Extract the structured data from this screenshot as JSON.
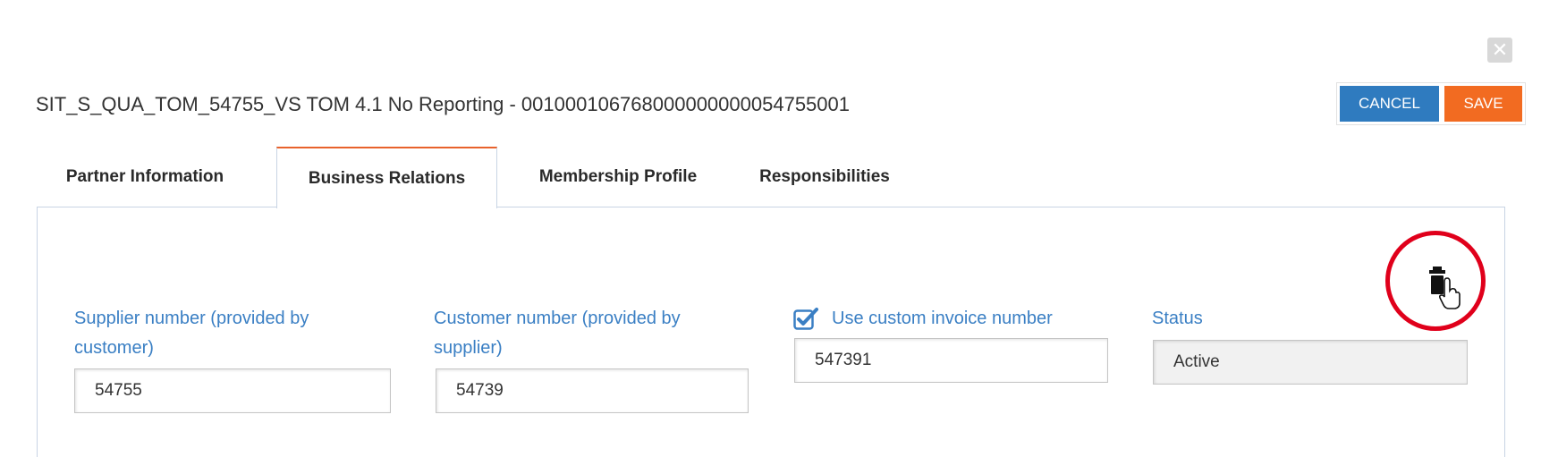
{
  "dialog": {
    "title": "SIT_S_QUA_TOM_54755_VS TOM 4.1 No Reporting - 001000106768000000000054755001",
    "close_icon": "close-icon",
    "actions": {
      "cancel_label": "CANCEL",
      "save_label": "SAVE",
      "cancel_color": "#2f7bbf",
      "save_color": "#f26b21"
    }
  },
  "tabs": [
    {
      "label": "Partner Information",
      "active": false
    },
    {
      "label": "Business Relations",
      "active": true
    },
    {
      "label": "Membership Profile",
      "active": false
    },
    {
      "label": "Responsibilities",
      "active": false
    }
  ],
  "fields": {
    "supplier_number": {
      "label_line1": "Supplier number (provided by",
      "label_line2": "customer)",
      "value": "54755"
    },
    "customer_number": {
      "label_line1": "Customer number (provided by",
      "label_line2": "supplier)",
      "value": "54739"
    },
    "custom_invoice": {
      "label": "Use custom invoice number",
      "checked": true,
      "value": "547391"
    },
    "status": {
      "label": "Status",
      "value": "Active"
    }
  },
  "delete_action": {
    "icon": "trash-icon",
    "highlight_color": "#e0001b"
  },
  "colors": {
    "label_blue": "#3a7fc4",
    "tab_accent": "#e8622c"
  }
}
